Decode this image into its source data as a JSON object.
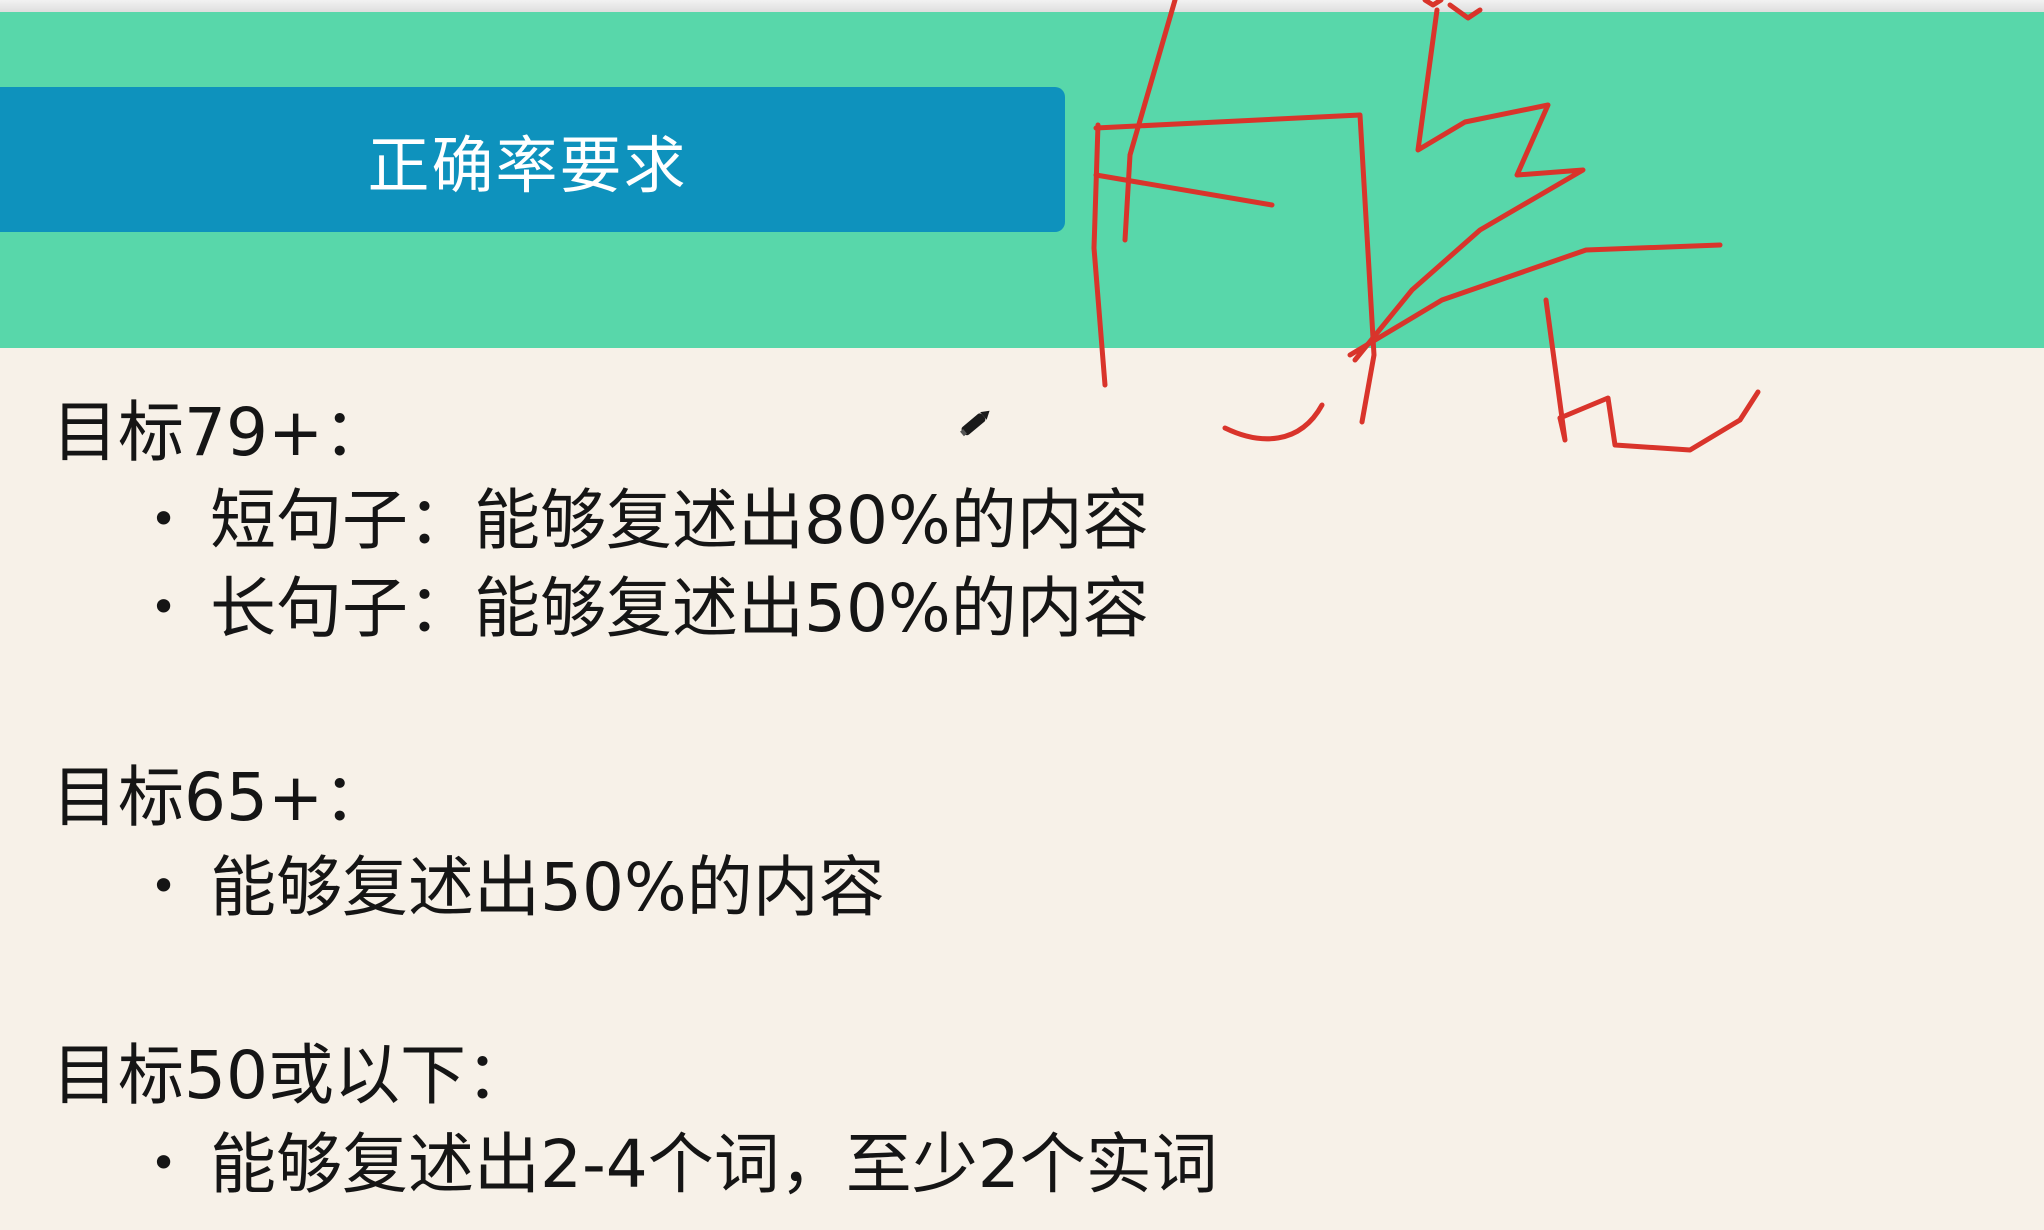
{
  "slide": {
    "title": "正确率要求",
    "colors": {
      "header_band": "#58d7aa",
      "title_box": "#0e92bd",
      "background": "#f7f1e8",
      "annotation_ink": "#d9342b"
    },
    "sections": [
      {
        "heading": "目标79+：",
        "bullets": [
          "短句子：能够复述出80%的内容",
          "长句子：能够复述出50%的内容"
        ]
      },
      {
        "heading": "目标65+：",
        "bullets": [
          "能够复述出50%的内容"
        ]
      },
      {
        "heading": "目标50或以下：",
        "bullets": [
          "能够复述出2-4个词，至少2个实词"
        ]
      }
    ]
  },
  "ui": {
    "bullet_glyph": "•",
    "pen_icon": "pen-icon",
    "annotation": "handwritten-red-ink"
  }
}
